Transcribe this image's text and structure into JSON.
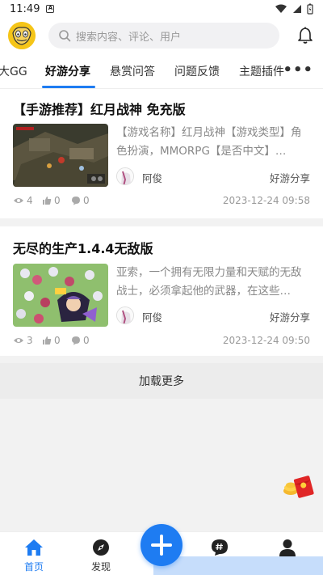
{
  "status": {
    "time": "11:49",
    "badge": "A"
  },
  "header": {
    "search_placeholder": "搜索内容、评论、用户"
  },
  "tabs": [
    {
      "label": "大GG"
    },
    {
      "label": "好游分享",
      "active": true
    },
    {
      "label": "悬赏问答"
    },
    {
      "label": "问题反馈"
    },
    {
      "label": "主题插件"
    }
  ],
  "posts": [
    {
      "title": "【手游推荐】红月战神 免充版",
      "excerpt": "【游戏名称】红月战神【游戏类型】角色扮演，MMORPG【是否中文】…",
      "author": "阿俊",
      "category": "好游分享",
      "views": "4",
      "likes": "0",
      "comments": "0",
      "date": "2023-12-24 09:58"
    },
    {
      "title": "无尽的生产1.4.4无敌版",
      "excerpt": "亚索，一个拥有无限力量和天赋的无敌战士，必须拿起他的武器，在这些…",
      "author": "阿俊",
      "category": "好游分享",
      "views": "3",
      "likes": "0",
      "comments": "0",
      "date": "2023-12-24 09:50"
    }
  ],
  "load_more": "加载更多",
  "nav": {
    "home": "首页",
    "discover": "发现"
  },
  "colors": {
    "accent": "#1e7cf2"
  }
}
